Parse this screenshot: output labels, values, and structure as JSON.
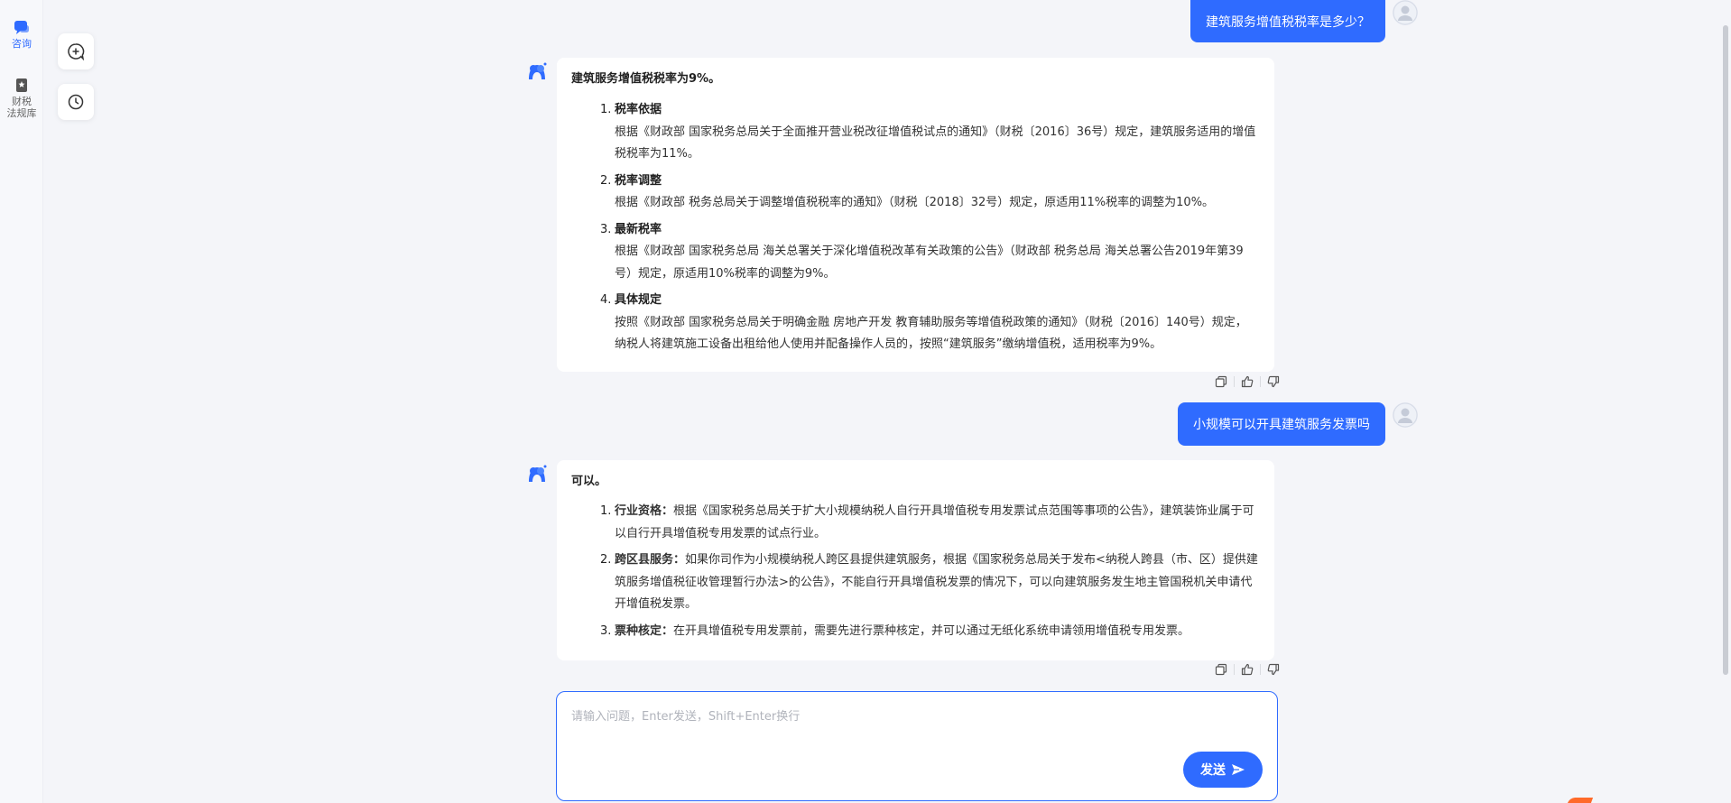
{
  "nav": {
    "items": [
      {
        "label": "咨询",
        "icon": "chat-bubbles-icon",
        "active": true
      },
      {
        "label": "财税法规库",
        "label_lines": [
          "财税",
          "法规库"
        ],
        "icon": "law-book-icon",
        "active": false
      }
    ]
  },
  "tools": {
    "new_chat_icon": "new-chat-icon",
    "history_icon": "history-clock-icon"
  },
  "conversation": [
    {
      "role": "user",
      "text": "建筑服务增值税税率是多少？"
    },
    {
      "role": "assistant",
      "lead": "建筑服务增值税税率为9%。",
      "items": [
        {
          "num": "1.",
          "title": "税率依据",
          "text": "根据《财政部 国家税务总局关于全面推开营业税改征增值税试点的通知》（财税〔2016〕36号）规定，建筑服务适用的增值税税率为11%。"
        },
        {
          "num": "2.",
          "title": "税率调整",
          "text": "根据《财政部 税务总局关于调整增值税税率的通知》（财税〔2018〕32号）规定，原适用11%税率的调整为10%。"
        },
        {
          "num": "3.",
          "title": "最新税率",
          "text": "根据《财政部 国家税务总局 海关总署关于深化增值税改革有关政策的公告》（财政部 税务总局 海关总署公告2019年第39号）规定，原适用10%税率的调整为9%。"
        },
        {
          "num": "4.",
          "title": "具体规定",
          "text": "按照《财政部 国家税务总局关于明确金融 房地产开发 教育辅助服务等增值税政策的通知》（财税〔2016〕140号）规定，纳税人将建筑施工设备出租给他人使用并配备操作人员的，按照“建筑服务”缴纳增值税，适用税率为9%。"
        }
      ]
    },
    {
      "role": "user",
      "text": "小规模可以开具建筑服务发票吗"
    },
    {
      "role": "assistant",
      "lead": "可以。",
      "items": [
        {
          "num": "1.",
          "title": "行业资格：",
          "text": "根据《国家税务总局关于扩大小规模纳税人自行开具增值税专用发票试点范围等事项的公告》，建筑装饰业属于可以自行开具增值税专用发票的试点行业。"
        },
        {
          "num": "2.",
          "title": "跨区县服务：",
          "text": "如果你司作为小规模纳税人跨区县提供建筑服务，根据《国家税务总局关于发布<纳税人跨县（市、区）提供建筑服务增值税征收管理暂行办法>的公告》，不能自行开具增值税发票的情况下，可以向建筑服务发生地主管国税机关申请代开增值税发票。"
        },
        {
          "num": "3.",
          "title": "票种核定：",
          "text": "在开具增值税专用发票前，需要先进行票种核定，并可以通过无纸化系统申请领用增值税专用发票。"
        }
      ]
    }
  ],
  "feedback": {
    "copy_icon": "copy-icon",
    "like_icon": "thumbs-up-icon",
    "dislike_icon": "thumbs-down-icon"
  },
  "composer": {
    "placeholder": "请输入问题，Enter发送，Shift+Enter换行",
    "value": "",
    "send_label": "发送",
    "send_icon": "send-arrow-icon"
  },
  "colors": {
    "accent": "#2f6bff",
    "background": "#f4f5f9",
    "card": "#ffffff"
  }
}
